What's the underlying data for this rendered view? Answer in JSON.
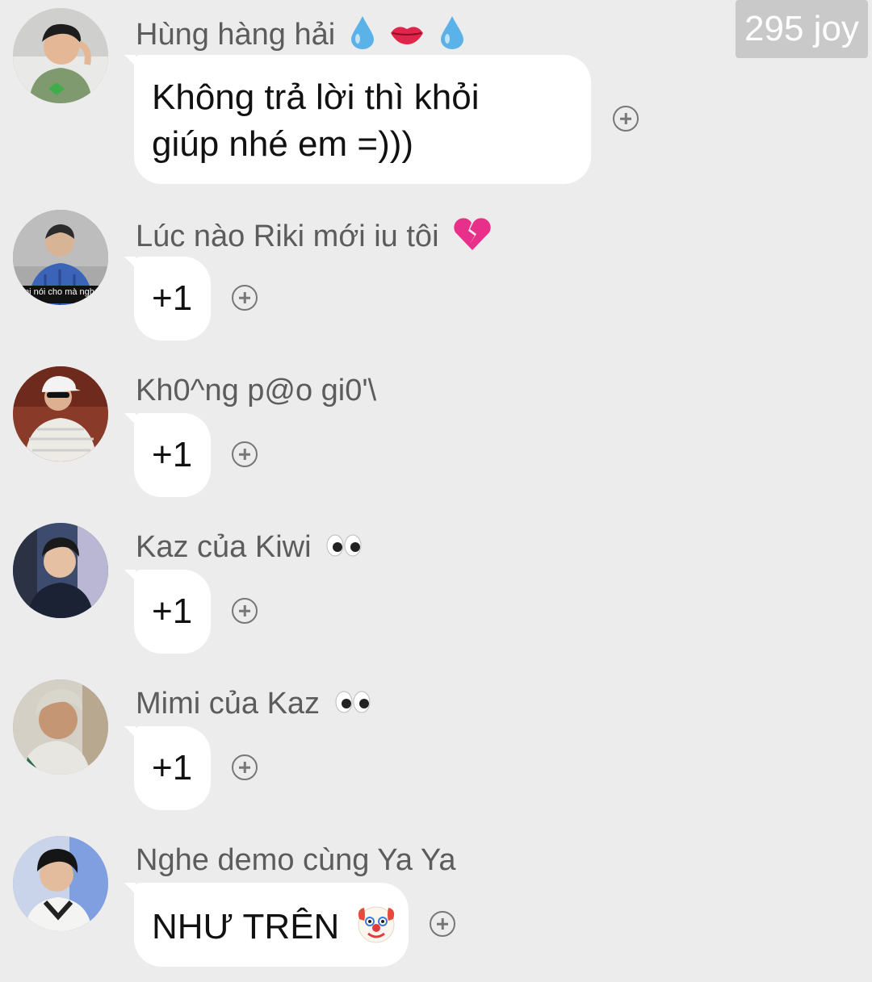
{
  "joy_badge": {
    "count": "295 joy"
  },
  "messages": [
    {
      "sender": "Hùng hàng hải",
      "sender_emoji": [
        "droplet-icon",
        "lips-icon",
        "droplet-icon"
      ],
      "text_lines": [
        "Không trả lời thì khỏi",
        "giúp nhé em =)))"
      ]
    },
    {
      "sender": "Lúc nào Riki mới iu tôi",
      "sender_emoji": [
        "broken-heart-icon"
      ],
      "avatar_caption": "mị nói cho mà nghe",
      "text": "+1"
    },
    {
      "sender": "Kh0^ng p@o gi0'\\",
      "sender_emoji": [],
      "text": "+1"
    },
    {
      "sender": "Kaz của Kiwi",
      "sender_emoji": [
        "eyes-icon"
      ],
      "text": "+1"
    },
    {
      "sender": "Mimi của Kaz",
      "sender_emoji": [
        "eyes-icon"
      ],
      "text": "+1"
    },
    {
      "sender": "Nghe demo cùng Ya Ya",
      "sender_emoji": [],
      "text": "NHƯ TRÊN",
      "text_emoji": "clown-face-icon"
    }
  ],
  "colors": {
    "background": "#ececec",
    "bubble": "#ffffff",
    "sender_text": "#5c5c5c",
    "badge": "#c9c9c9"
  }
}
